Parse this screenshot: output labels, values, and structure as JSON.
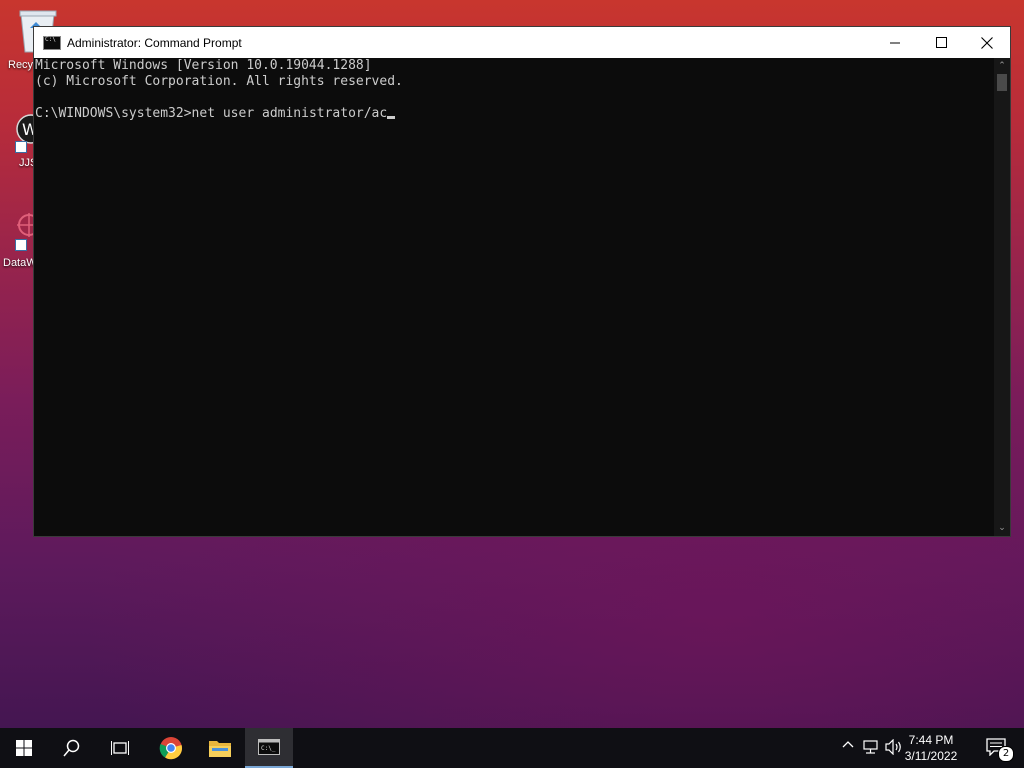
{
  "desktop": {
    "icons": [
      {
        "label": "Recy",
        "icon": "recycle-bin-icon"
      },
      {
        "label": "JJS",
        "icon": "app-shortcut-icon"
      },
      {
        "label": "DataW",
        "icon": "app-shortcut-icon"
      }
    ]
  },
  "window": {
    "title": "Administrator: Command Prompt",
    "icon": "console-icon",
    "controls": [
      "minimize-icon",
      "maximize-icon",
      "close-icon"
    ]
  },
  "console": {
    "lines": [
      "Microsoft Windows [Version 10.0.19044.1288]",
      "(c) Microsoft Corporation. All rights reserved.",
      ""
    ],
    "prompt": "C:\\WINDOWS\\system32>",
    "input": "net user administrator/ac"
  },
  "taskbar": {
    "items": [
      "windows-start-icon",
      "search-icon",
      "task-view-icon",
      "chrome-icon",
      "file-explorer-icon",
      "command-prompt-icon"
    ],
    "clock_time": "7:44 PM",
    "clock_date": "3/11/2022",
    "notification_count": "2"
  }
}
